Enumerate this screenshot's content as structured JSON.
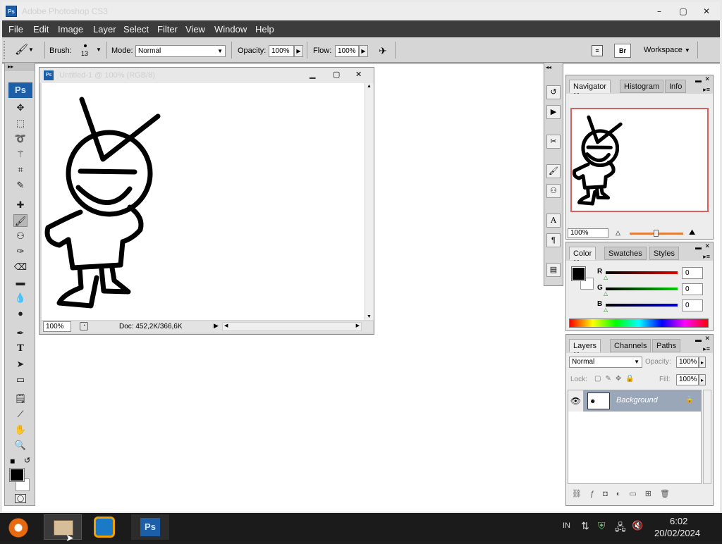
{
  "window": {
    "title": "Adobe Photoshop CS3",
    "ps_badge": "Ps"
  },
  "menu": [
    "File",
    "Edit",
    "Image",
    "Layer",
    "Select",
    "Filter",
    "View",
    "Window",
    "Help"
  ],
  "options": {
    "brush_label": "Brush:",
    "brush_size": "13",
    "mode_label": "Mode:",
    "mode_value": "Normal",
    "opacity_label": "Opacity:",
    "opacity_value": "100%",
    "flow_label": "Flow:",
    "flow_value": "100%",
    "workspace_label": "Workspace"
  },
  "toolbox": {
    "logo": "Ps"
  },
  "document": {
    "title": "Untitled-1 @ 100% (RGB/8)",
    "zoom": "100%",
    "doc_info": "Doc: 452,2K/366,6K"
  },
  "navigator_panel": {
    "tabs": [
      "Navigator",
      "Histogram",
      "Info"
    ],
    "zoom": "100%"
  },
  "color_panel": {
    "tabs": [
      "Color",
      "Swatches",
      "Styles"
    ],
    "channels": [
      {
        "label": "R",
        "value": "0",
        "color": "#c00000"
      },
      {
        "label": "G",
        "value": "0",
        "color": "#00b000"
      },
      {
        "label": "B",
        "value": "0",
        "color": "#0000c0"
      }
    ]
  },
  "layers_panel": {
    "tabs": [
      "Layers",
      "Channels",
      "Paths"
    ],
    "blend_mode": "Normal",
    "opacity_label": "Opacity:",
    "opacity_value": "100%",
    "lock_label": "Lock:",
    "fill_label": "Fill:",
    "fill_value": "100%",
    "layer_name": "Background"
  },
  "taskbar": {
    "language": "IN",
    "time": "6:02",
    "date": "20/02/2024",
    "ps_badge": "Ps"
  },
  "colors": {
    "accent": "#1c5ea8",
    "menubar": "#3c3c3c",
    "layer_selected": "#9aa7b8"
  }
}
